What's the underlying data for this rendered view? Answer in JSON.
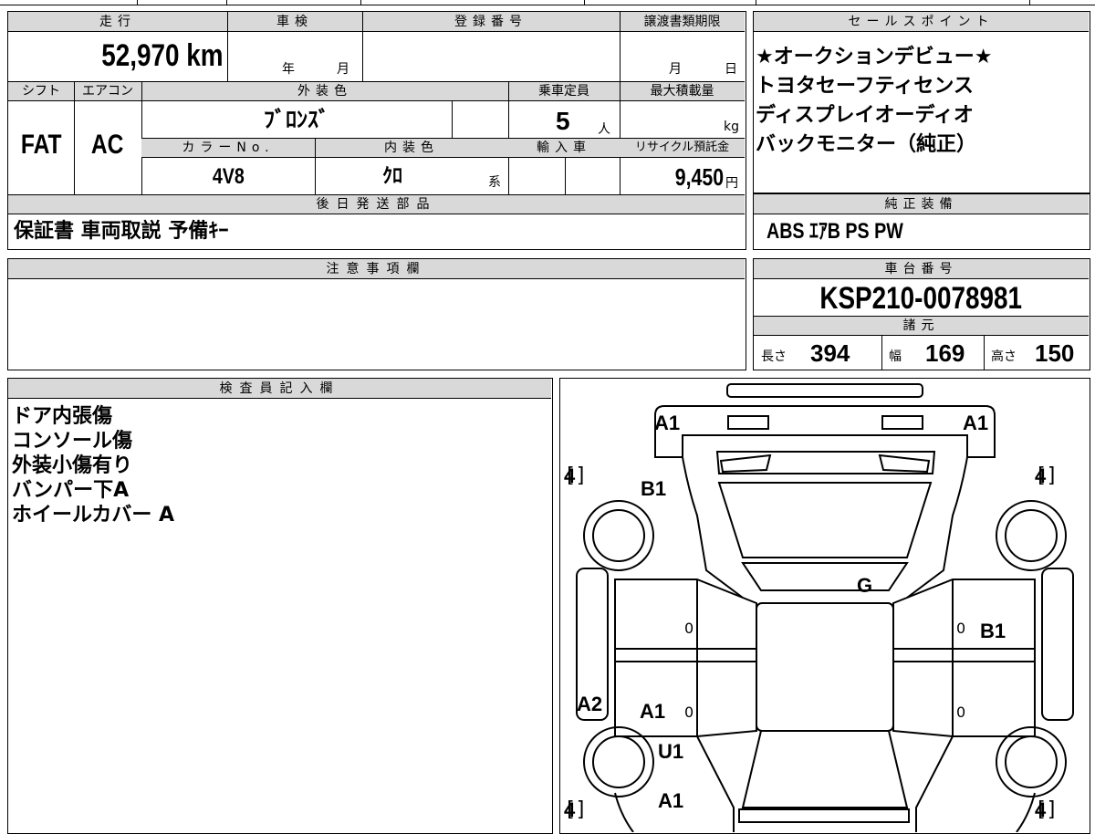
{
  "basic": {
    "mileage_header": "走行",
    "mileage_value": "52,970 km",
    "inspection_header": "車検",
    "inspection_year_unit": "年",
    "inspection_month_unit": "月",
    "registration_header": "登録番号",
    "transfer_header": "譲渡書類期限",
    "transfer_month_unit": "月",
    "transfer_day_unit": "日",
    "shift_header": "シフト",
    "shift_value": "FAT",
    "ac_header": "エアコン",
    "ac_value": "AC",
    "exterior_color_header": "外装色",
    "exterior_color_value": "ﾌﾞﾛﾝｽﾞ",
    "capacity_header": "乗車定員",
    "capacity_value": "5",
    "capacity_unit": "人",
    "max_load_header": "最大積載量",
    "max_load_unit": "kg",
    "color_no_header": "カラーNo.",
    "color_no_value": "4V8",
    "interior_color_header": "内装色",
    "interior_color_value": "ｸﾛ",
    "interior_color_suffix": "系",
    "import_header": "輸入車",
    "recycle_header": "リサイクル預託金",
    "recycle_value": "9,450",
    "recycle_unit": "円"
  },
  "later_parts": {
    "header": "後日発送部品",
    "value": "保証書 車両取説 予備ｷｰ"
  },
  "sales_points": {
    "header": "セールスポイント",
    "lines": [
      "★オークションデビュー★",
      "トヨタセーフティセンス",
      "ディスプレイオーディオ",
      "バックモニター（純正）"
    ]
  },
  "standard_equipment": {
    "header": "純正装備",
    "value": "ABS ｴｱB PS PW"
  },
  "notes": {
    "header": "注意事項欄"
  },
  "chassis": {
    "header": "車台番号",
    "value": "KSP210-0078981"
  },
  "specs": {
    "header": "諸元",
    "length_label": "長さ",
    "length_value": "394",
    "width_label": "幅",
    "width_value": "169",
    "height_label": "高さ",
    "height_value": "150"
  },
  "inspector": {
    "header": "検査員記入欄",
    "lines": [
      "ドア内張傷",
      "コンソール傷",
      "外装小傷有り",
      "バンパー下A",
      "ホイールカバー A"
    ]
  },
  "diagram": {
    "marks": {
      "front_left": "A1",
      "front_right": "A1",
      "left_front_fender": "B1",
      "windshield": "G",
      "right_front_door": "B1",
      "left_rocker": "A2",
      "left_rear_door": "A1",
      "left_rear_fender_u": "U1",
      "left_rear_fender_a": "A1"
    },
    "tire_values": [
      "4",
      "4",
      "4",
      "4"
    ],
    "door_values": [
      "0",
      "0",
      "0",
      "0"
    ]
  }
}
